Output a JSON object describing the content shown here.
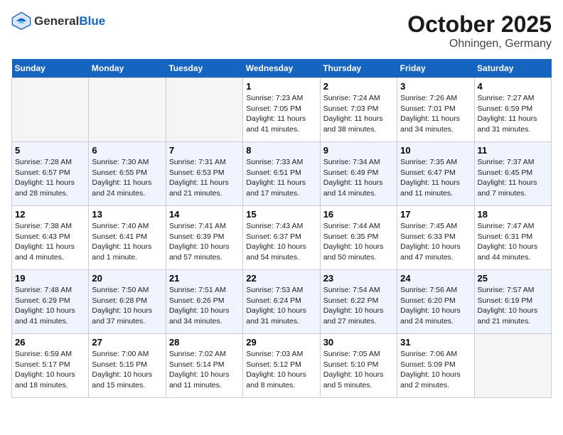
{
  "header": {
    "logo_line1": "General",
    "logo_line2": "Blue",
    "month": "October 2025",
    "location": "Ohningen, Germany"
  },
  "days_of_week": [
    "Sunday",
    "Monday",
    "Tuesday",
    "Wednesday",
    "Thursday",
    "Friday",
    "Saturday"
  ],
  "weeks": [
    [
      {
        "day": null,
        "info": null
      },
      {
        "day": null,
        "info": null
      },
      {
        "day": null,
        "info": null
      },
      {
        "day": "1",
        "info": "Sunrise: 7:23 AM\nSunset: 7:05 PM\nDaylight: 11 hours and 41 minutes."
      },
      {
        "day": "2",
        "info": "Sunrise: 7:24 AM\nSunset: 7:03 PM\nDaylight: 11 hours and 38 minutes."
      },
      {
        "day": "3",
        "info": "Sunrise: 7:26 AM\nSunset: 7:01 PM\nDaylight: 11 hours and 34 minutes."
      },
      {
        "day": "4",
        "info": "Sunrise: 7:27 AM\nSunset: 6:59 PM\nDaylight: 11 hours and 31 minutes."
      }
    ],
    [
      {
        "day": "5",
        "info": "Sunrise: 7:28 AM\nSunset: 6:57 PM\nDaylight: 11 hours and 28 minutes."
      },
      {
        "day": "6",
        "info": "Sunrise: 7:30 AM\nSunset: 6:55 PM\nDaylight: 11 hours and 24 minutes."
      },
      {
        "day": "7",
        "info": "Sunrise: 7:31 AM\nSunset: 6:53 PM\nDaylight: 11 hours and 21 minutes."
      },
      {
        "day": "8",
        "info": "Sunrise: 7:33 AM\nSunset: 6:51 PM\nDaylight: 11 hours and 17 minutes."
      },
      {
        "day": "9",
        "info": "Sunrise: 7:34 AM\nSunset: 6:49 PM\nDaylight: 11 hours and 14 minutes."
      },
      {
        "day": "10",
        "info": "Sunrise: 7:35 AM\nSunset: 6:47 PM\nDaylight: 11 hours and 11 minutes."
      },
      {
        "day": "11",
        "info": "Sunrise: 7:37 AM\nSunset: 6:45 PM\nDaylight: 11 hours and 7 minutes."
      }
    ],
    [
      {
        "day": "12",
        "info": "Sunrise: 7:38 AM\nSunset: 6:43 PM\nDaylight: 11 hours and 4 minutes."
      },
      {
        "day": "13",
        "info": "Sunrise: 7:40 AM\nSunset: 6:41 PM\nDaylight: 11 hours and 1 minute."
      },
      {
        "day": "14",
        "info": "Sunrise: 7:41 AM\nSunset: 6:39 PM\nDaylight: 10 hours and 57 minutes."
      },
      {
        "day": "15",
        "info": "Sunrise: 7:43 AM\nSunset: 6:37 PM\nDaylight: 10 hours and 54 minutes."
      },
      {
        "day": "16",
        "info": "Sunrise: 7:44 AM\nSunset: 6:35 PM\nDaylight: 10 hours and 50 minutes."
      },
      {
        "day": "17",
        "info": "Sunrise: 7:45 AM\nSunset: 6:33 PM\nDaylight: 10 hours and 47 minutes."
      },
      {
        "day": "18",
        "info": "Sunrise: 7:47 AM\nSunset: 6:31 PM\nDaylight: 10 hours and 44 minutes."
      }
    ],
    [
      {
        "day": "19",
        "info": "Sunrise: 7:48 AM\nSunset: 6:29 PM\nDaylight: 10 hours and 41 minutes."
      },
      {
        "day": "20",
        "info": "Sunrise: 7:50 AM\nSunset: 6:28 PM\nDaylight: 10 hours and 37 minutes."
      },
      {
        "day": "21",
        "info": "Sunrise: 7:51 AM\nSunset: 6:26 PM\nDaylight: 10 hours and 34 minutes."
      },
      {
        "day": "22",
        "info": "Sunrise: 7:53 AM\nSunset: 6:24 PM\nDaylight: 10 hours and 31 minutes."
      },
      {
        "day": "23",
        "info": "Sunrise: 7:54 AM\nSunset: 6:22 PM\nDaylight: 10 hours and 27 minutes."
      },
      {
        "day": "24",
        "info": "Sunrise: 7:56 AM\nSunset: 6:20 PM\nDaylight: 10 hours and 24 minutes."
      },
      {
        "day": "25",
        "info": "Sunrise: 7:57 AM\nSunset: 6:19 PM\nDaylight: 10 hours and 21 minutes."
      }
    ],
    [
      {
        "day": "26",
        "info": "Sunrise: 6:59 AM\nSunset: 5:17 PM\nDaylight: 10 hours and 18 minutes."
      },
      {
        "day": "27",
        "info": "Sunrise: 7:00 AM\nSunset: 5:15 PM\nDaylight: 10 hours and 15 minutes."
      },
      {
        "day": "28",
        "info": "Sunrise: 7:02 AM\nSunset: 5:14 PM\nDaylight: 10 hours and 11 minutes."
      },
      {
        "day": "29",
        "info": "Sunrise: 7:03 AM\nSunset: 5:12 PM\nDaylight: 10 hours and 8 minutes."
      },
      {
        "day": "30",
        "info": "Sunrise: 7:05 AM\nSunset: 5:10 PM\nDaylight: 10 hours and 5 minutes."
      },
      {
        "day": "31",
        "info": "Sunrise: 7:06 AM\nSunset: 5:09 PM\nDaylight: 10 hours and 2 minutes."
      },
      {
        "day": null,
        "info": null
      }
    ]
  ]
}
